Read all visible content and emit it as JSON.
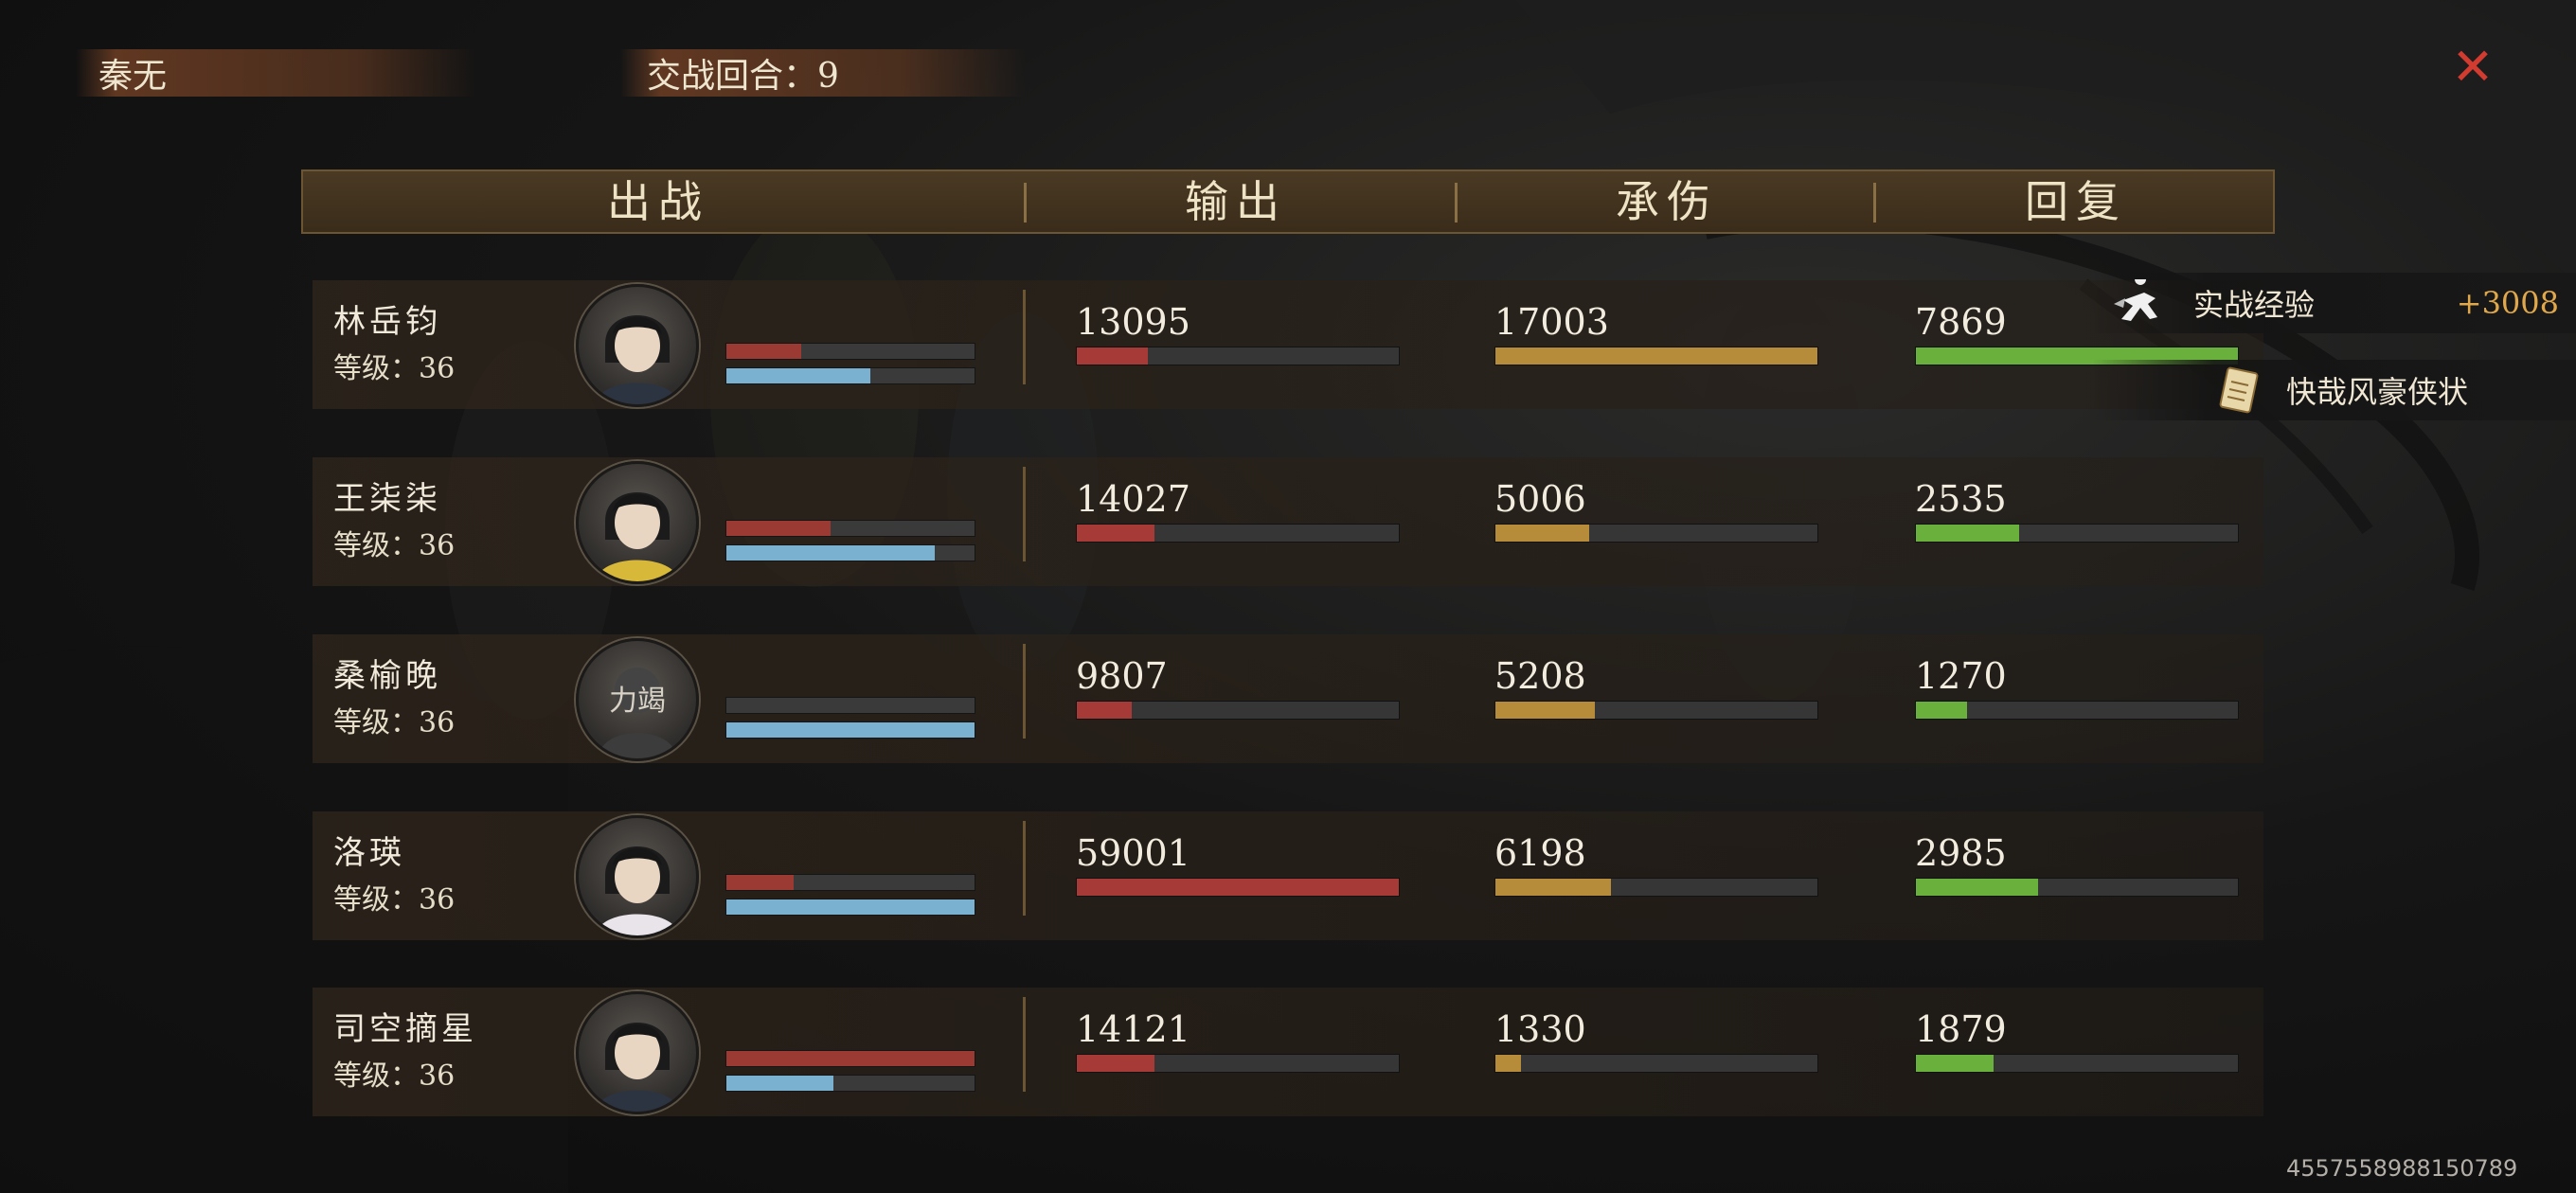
{
  "top": {
    "player_name": "秦无",
    "battle_rounds": "交战回合：9"
  },
  "header": {
    "col_deploy": "出战",
    "col_output": "输出",
    "col_damage_taken": "承伤",
    "col_recovery": "回复"
  },
  "rows": [
    {
      "name": "林岳钧",
      "level": "等级：36",
      "output": "13095",
      "taken": "17003",
      "recovery": "7869",
      "hp_red": 0.3,
      "hp_blue": 0.58,
      "output_frac": 0.22,
      "taken_frac": 1.0,
      "recovery_frac": 1.0,
      "avatar": "male-swordsman-portrait"
    },
    {
      "name": "王柒柒",
      "level": "等级：36",
      "output": "14027",
      "taken": "5006",
      "recovery": "2535",
      "hp_red": 0.42,
      "hp_blue": 0.84,
      "output_frac": 0.24,
      "taken_frac": 0.29,
      "recovery_frac": 0.32,
      "avatar": "female-yellow-dress-portrait"
    },
    {
      "name": "桑榆晚",
      "level": "等级：36",
      "output": "9807",
      "taken": "5208",
      "recovery": "1270",
      "avatar_status": "力竭",
      "hp_red": 0.0,
      "hp_blue": 1.0,
      "output_frac": 0.17,
      "taken_frac": 0.31,
      "recovery_frac": 0.16,
      "avatar": "exhausted-portrait"
    },
    {
      "name": "洛瑛",
      "level": "等级：36",
      "output": "59001",
      "taken": "6198",
      "recovery": "2985",
      "hp_red": 0.27,
      "hp_blue": 1.0,
      "output_frac": 1.0,
      "taken_frac": 0.36,
      "recovery_frac": 0.38,
      "avatar": "female-white-dress-portrait"
    },
    {
      "name": "司空摘星",
      "level": "等级：36",
      "output": "14121",
      "taken": "1330",
      "recovery": "1879",
      "hp_red": 1.0,
      "hp_blue": 0.43,
      "output_frac": 0.24,
      "taken_frac": 0.08,
      "recovery_frac": 0.24,
      "avatar": "male-young-portrait"
    }
  ],
  "rewards": {
    "exp_label": "实战经验",
    "exp_value": "+3008",
    "item_label": "快哉风豪侠状"
  },
  "footer_id": "4557558988150789",
  "colors": {
    "hp_red": "#9b3a33",
    "hp_blue": "#7ab0d0",
    "output_red": "#a63a36",
    "taken_gold": "#b68b3a",
    "recovery_green": "#6ab03c",
    "close_red": "#d23b2f",
    "exp_orange": "#e0a84a"
  }
}
